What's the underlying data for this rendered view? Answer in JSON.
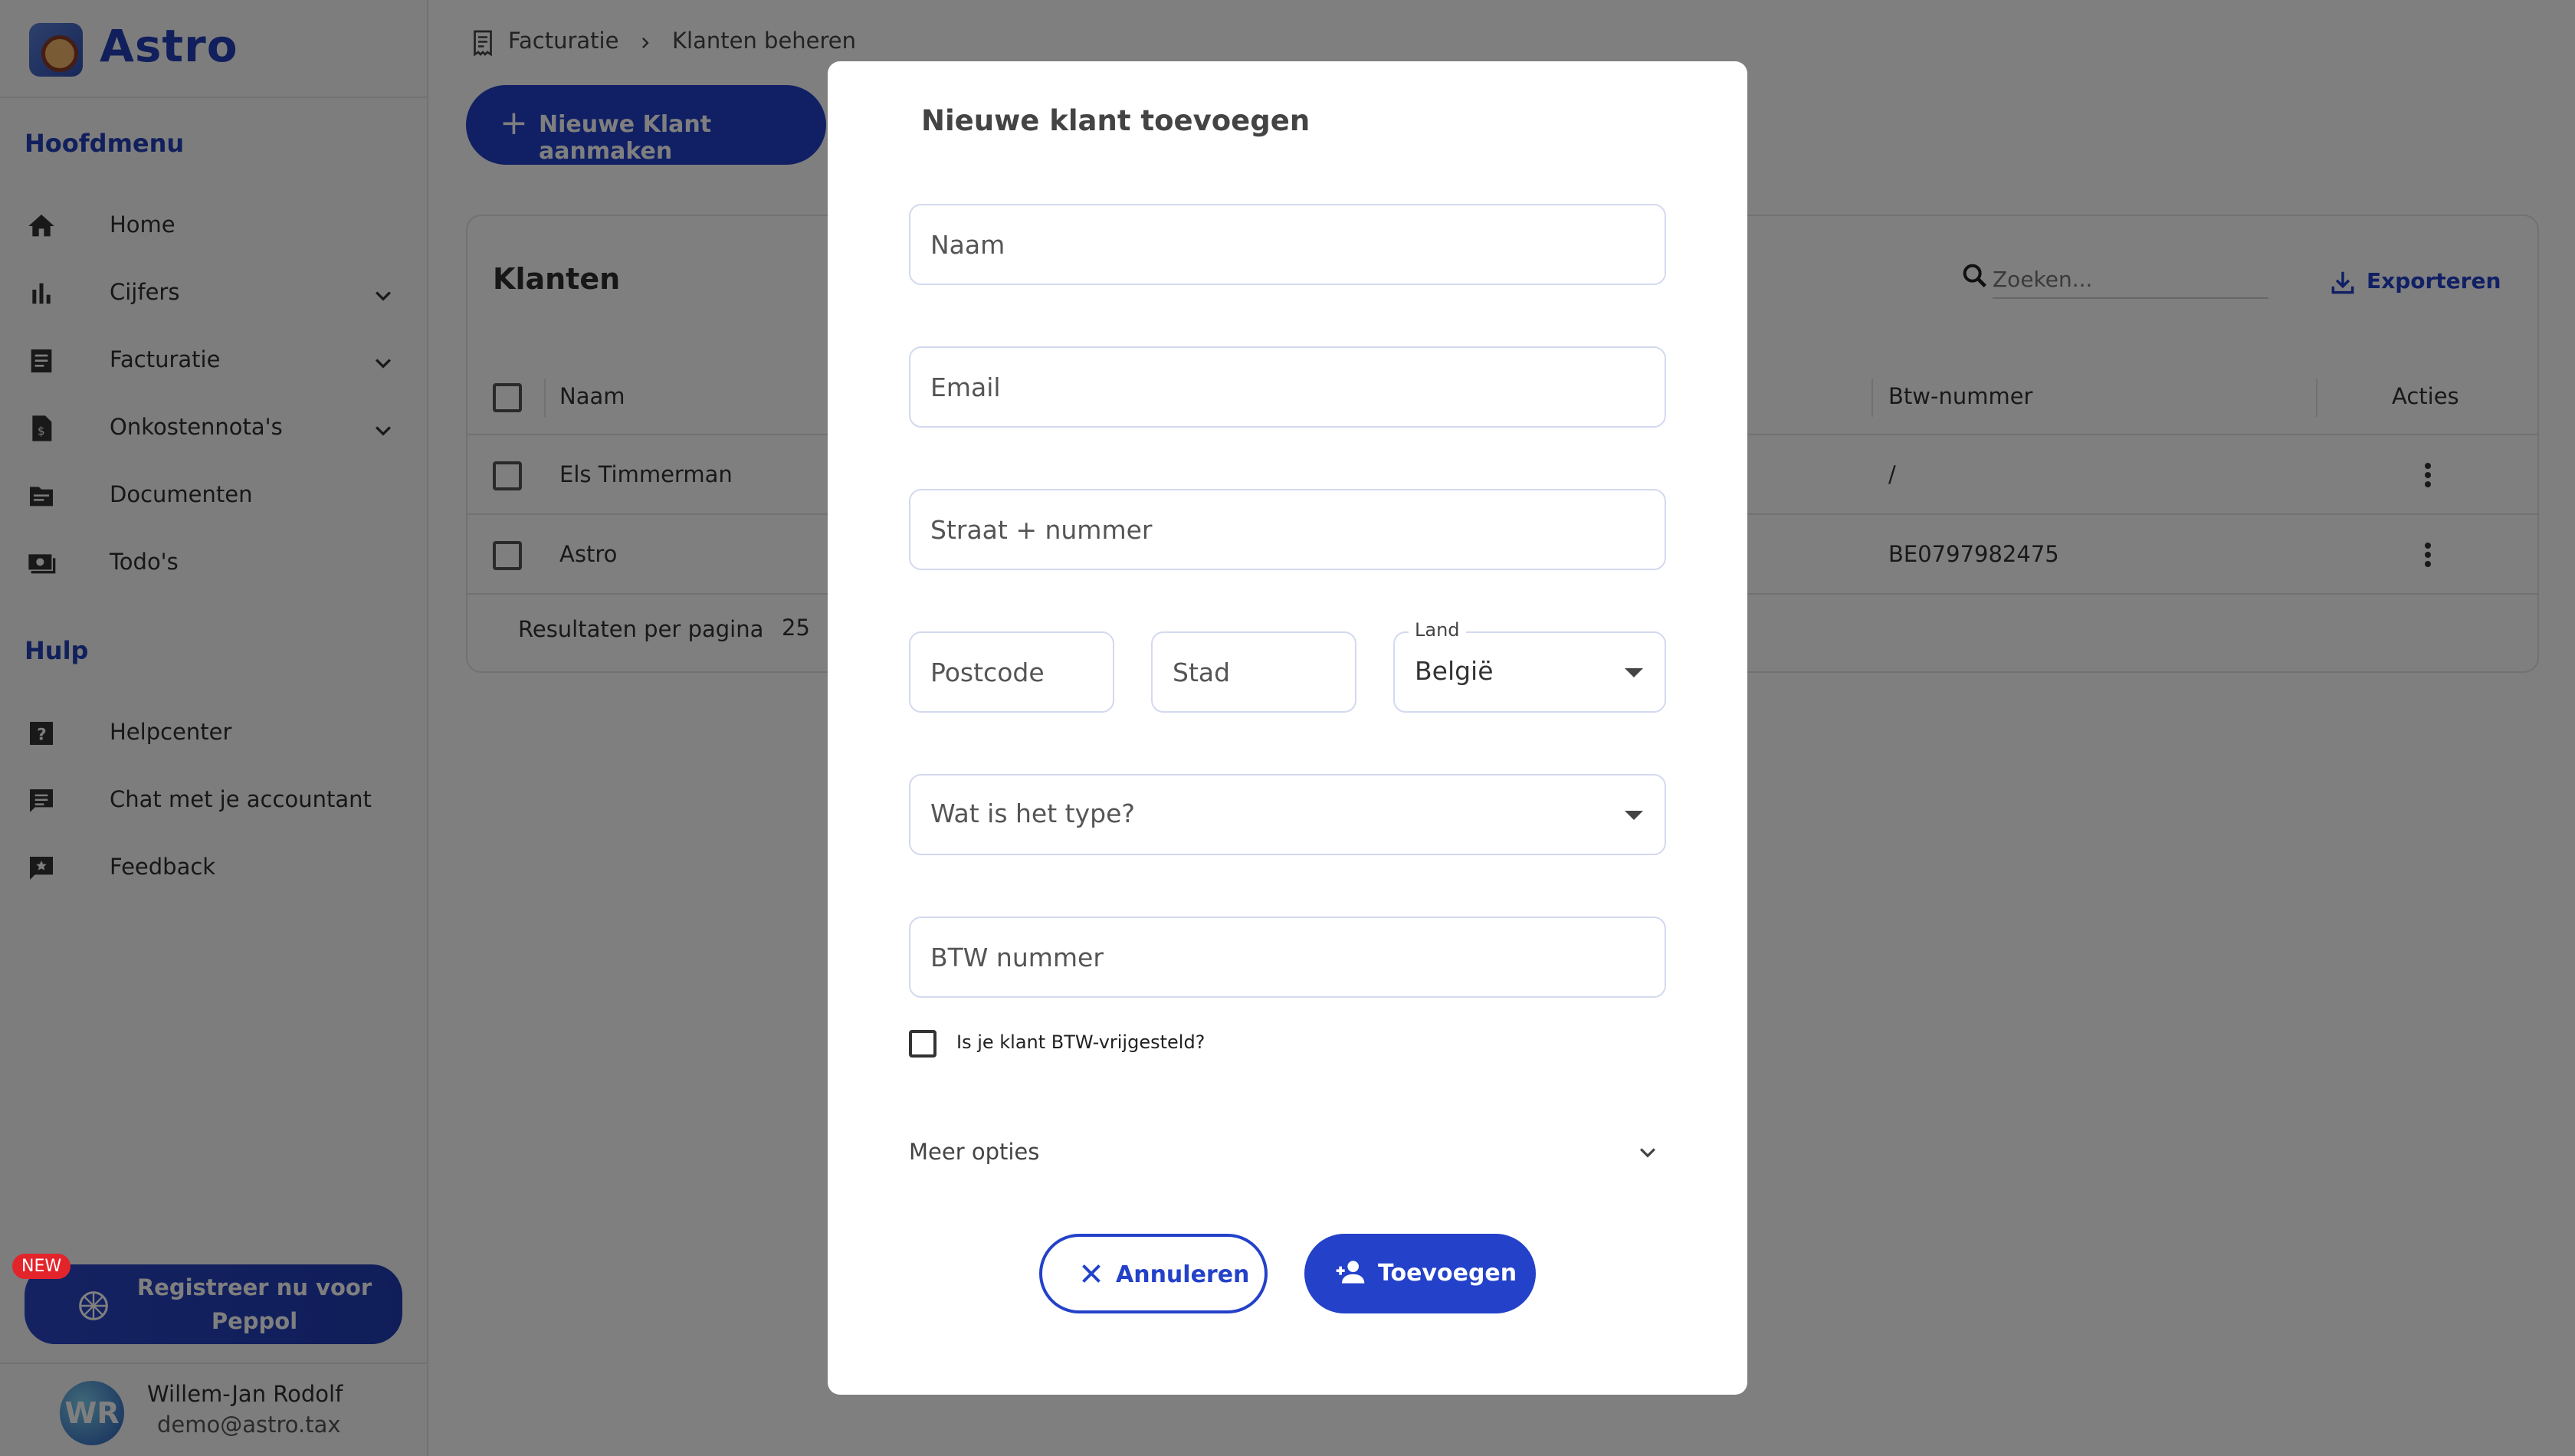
{
  "brand": {
    "name": "Astro"
  },
  "sidebar": {
    "main_title": "Hoofdmenu",
    "items": [
      {
        "label": "Home",
        "icon": "home-icon"
      },
      {
        "label": "Cijfers",
        "icon": "bar-chart-icon",
        "expandable": true
      },
      {
        "label": "Facturatie",
        "icon": "list-icon",
        "expandable": true
      },
      {
        "label": "Onkostennota's",
        "icon": "receipt-icon",
        "expandable": true
      },
      {
        "label": "Documenten",
        "icon": "folder-icon"
      },
      {
        "label": "Todo's",
        "icon": "todo-icon"
      }
    ],
    "help_title": "Hulp",
    "help_items": [
      {
        "label": "Helpcenter",
        "icon": "help-icon"
      },
      {
        "label": "Chat met je accountant",
        "icon": "chat-icon"
      },
      {
        "label": "Feedback",
        "icon": "feedback-icon"
      }
    ],
    "peppol": {
      "badge": "NEW",
      "label": "Registreer nu voor Peppol"
    },
    "user": {
      "initials": "WR",
      "name": "Willem-Jan Rodolf",
      "email": "demo@astro.tax"
    }
  },
  "breadcrumb": {
    "parent": "Facturatie",
    "current": "Klanten beheren"
  },
  "toolbar": {
    "new_client": "Nieuwe Klant aanmaken"
  },
  "table": {
    "title": "Klanten",
    "search_placeholder": "Zoeken...",
    "export_label": "Exporteren",
    "columns": {
      "name": "Naam",
      "vat": "Btw-nummer",
      "actions": "Acties"
    },
    "rows": [
      {
        "name": "Els Timmerman",
        "vat": "/"
      },
      {
        "name": "Astro",
        "vat": "BE0797982475"
      }
    ],
    "per_page_label": "Resultaten per pagina",
    "per_page_value": "25"
  },
  "modal": {
    "title": "Nieuwe klant toevoegen",
    "fields": {
      "name_placeholder": "Naam",
      "email_placeholder": "Email",
      "street_placeholder": "Straat + nummer",
      "postcode_placeholder": "Postcode",
      "city_placeholder": "Stad",
      "country_label": "Land",
      "country_value": "België",
      "type_placeholder": "Wat is het type?",
      "vat_placeholder": "BTW nummer"
    },
    "vat_exempt_label": "Is je klant BTW-vrijgesteld?",
    "more_options": "Meer opties",
    "cancel_label": "Annuleren",
    "add_label": "Toevoegen"
  },
  "colors": {
    "accent": "#2341C9",
    "brand": "#2341B8",
    "overlay": "rgba(0,0,0,0.5)"
  }
}
